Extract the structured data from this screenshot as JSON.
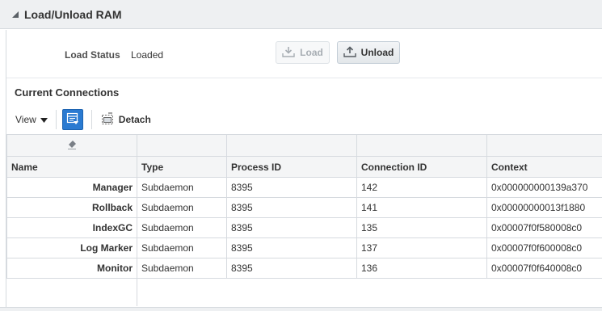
{
  "panel": {
    "title": "Load/Unload RAM"
  },
  "status": {
    "label": "Load Status",
    "value": "Loaded"
  },
  "buttons": {
    "load_label": "Load",
    "unload_label": "Unload"
  },
  "section": {
    "title": "Current Connections"
  },
  "toolbar": {
    "view_label": "View",
    "detach_label": "Detach"
  },
  "table": {
    "columns": [
      "Name",
      "Type",
      "Process ID",
      "Connection ID",
      "Context"
    ],
    "rows": [
      [
        "Manager",
        "Subdaemon",
        "8395",
        "142",
        "0x000000000139a370"
      ],
      [
        "Rollback",
        "Subdaemon",
        "8395",
        "141",
        "0x00000000013f1880"
      ],
      [
        "IndexGC",
        "Subdaemon",
        "8395",
        "135",
        "0x00007f0f580008c0"
      ],
      [
        "Log Marker",
        "Subdaemon",
        "8395",
        "137",
        "0x00007f0f600008c0"
      ],
      [
        "Monitor",
        "Subdaemon",
        "8395",
        "136",
        "0x00007f0f640008c0"
      ]
    ]
  },
  "icons": {
    "collapse": "triangle-collapse-icon",
    "load": "download-tray-icon",
    "unload": "upload-tray-icon",
    "view_dropdown": "caret-down-icon",
    "freeze": "freeze-columns-icon",
    "detach": "detach-window-icon",
    "filter_clear": "eraser-icon"
  },
  "colors": {
    "header_bg": "#eef0f2",
    "accent_blue": "#2a7ad1",
    "border": "#d6dadf"
  }
}
